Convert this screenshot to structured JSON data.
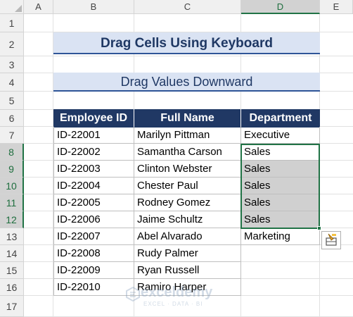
{
  "columns": [
    "A",
    "B",
    "C",
    "D",
    "E"
  ],
  "rows": [
    "1",
    "2",
    "3",
    "4",
    "5",
    "6",
    "7",
    "8",
    "9",
    "10",
    "11",
    "12",
    "13",
    "14",
    "15",
    "16",
    "17"
  ],
  "title": "Drag Cells Using Keyboard",
  "subtitle": "Drag Values Downward",
  "table": {
    "headers": [
      "Employee ID",
      "Full Name",
      "Department"
    ],
    "rows": [
      [
        "ID-22001",
        "Marilyn Pittman",
        "Executive"
      ],
      [
        "ID-22002",
        "Samantha Carson",
        "Sales"
      ],
      [
        "ID-22003",
        "Clinton Webster",
        "Sales"
      ],
      [
        "ID-22004",
        "Chester Paul",
        "Sales"
      ],
      [
        "ID-22005",
        "Rodney Gomez",
        "Sales"
      ],
      [
        "ID-22006",
        "Jaime Schultz",
        "Sales"
      ],
      [
        "ID-22007",
        "Abel Alvarado",
        "Marketing"
      ],
      [
        "ID-22008",
        "Rudy Palmer",
        ""
      ],
      [
        "ID-22009",
        "Ryan Russell",
        ""
      ],
      [
        "ID-22010",
        "Ramiro Harper",
        ""
      ]
    ]
  },
  "watermark": {
    "name": "exceldemy",
    "tagline": "EXCEL · DATA · BI"
  },
  "colors": {
    "header_fill": "#203864",
    "title_fill": "#dae3f3",
    "selection": "#217346"
  },
  "icons": {
    "autofill_options": "autofill-options-icon"
  }
}
